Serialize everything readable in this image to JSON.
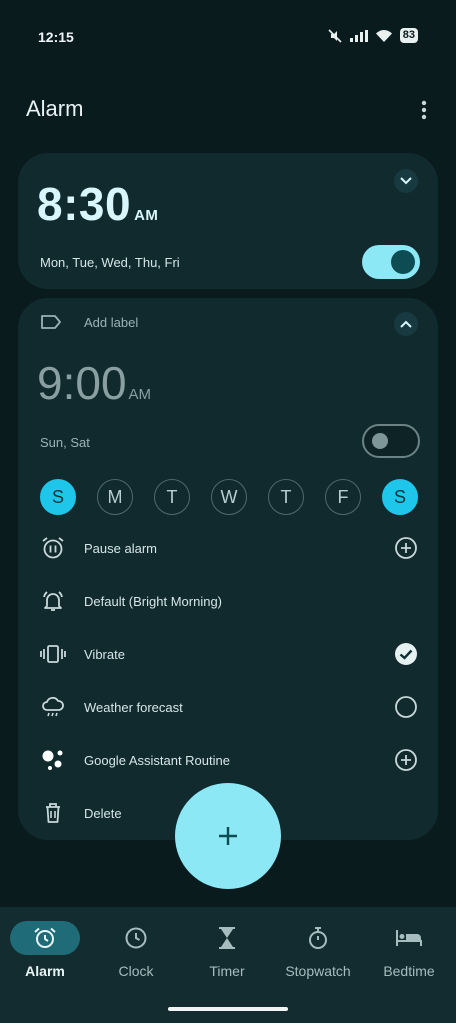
{
  "status_bar": {
    "time": "12:15",
    "battery": "83"
  },
  "header": {
    "title": "Alarm"
  },
  "alarm1": {
    "time": "8:30",
    "ampm": "AM",
    "days": "Mon, Tue, Wed, Thu, Fri",
    "enabled": true
  },
  "alarm2": {
    "label_placeholder": "Add label",
    "time": "9:00",
    "ampm": "AM",
    "days": "Sun, Sat",
    "enabled": false,
    "weekdays": [
      {
        "letter": "S",
        "selected": true
      },
      {
        "letter": "M",
        "selected": false
      },
      {
        "letter": "T",
        "selected": false
      },
      {
        "letter": "W",
        "selected": false
      },
      {
        "letter": "T",
        "selected": false
      },
      {
        "letter": "F",
        "selected": false
      },
      {
        "letter": "S",
        "selected": true
      }
    ],
    "options": {
      "pause": "Pause alarm",
      "sound": "Default (Bright Morning)",
      "vibrate": "Vibrate",
      "weather": "Weather forecast",
      "assistant": "Google Assistant Routine",
      "delete": "Delete"
    }
  },
  "bottom_nav": [
    {
      "label": "Alarm",
      "icon": "alarm-icon",
      "active": true
    },
    {
      "label": "Clock",
      "icon": "clock-icon",
      "active": false
    },
    {
      "label": "Timer",
      "icon": "hourglass-icon",
      "active": false
    },
    {
      "label": "Stopwatch",
      "icon": "stopwatch-icon",
      "active": false
    },
    {
      "label": "Bedtime",
      "icon": "bed-icon",
      "active": false
    }
  ],
  "colors": {
    "accent": "#8de8f5",
    "selected_day": "#1ec6ea",
    "background": "#0a1b1e",
    "card": "#102a2e"
  }
}
